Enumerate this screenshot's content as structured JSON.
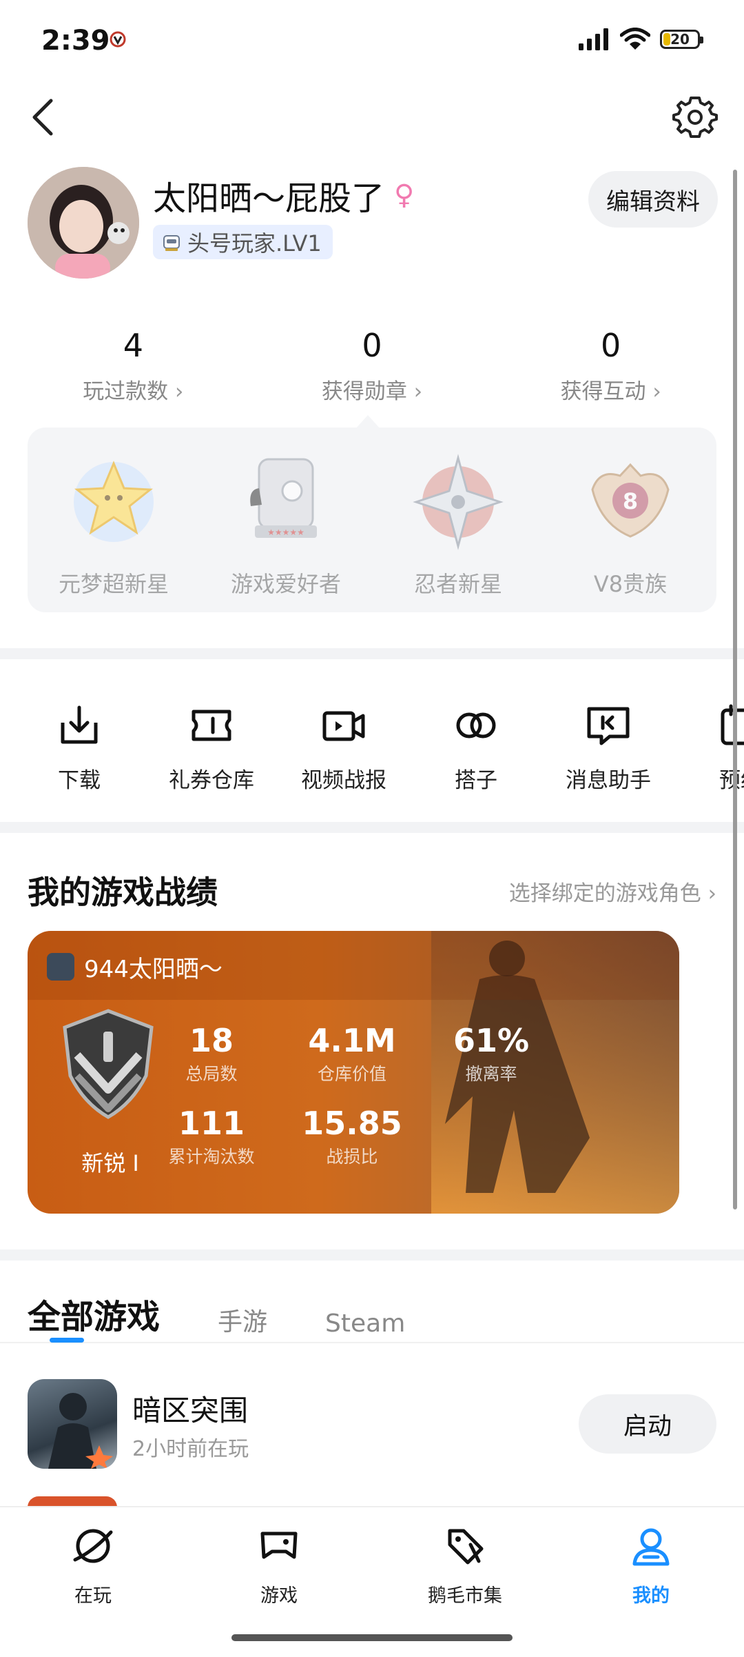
{
  "status_bar": {
    "time": "2:39",
    "battery": "20"
  },
  "profile": {
    "username": "太阳晒～屁股了",
    "gender_symbol": "♀",
    "level": "头号玩家.LV1",
    "edit_label": "编辑资料"
  },
  "stats": [
    {
      "value": "4",
      "label": "玩过款数"
    },
    {
      "value": "0",
      "label": "获得勋章"
    },
    {
      "value": "0",
      "label": "获得互动"
    }
  ],
  "badges": [
    {
      "label": "元梦超新星",
      "icon": "star-badge-icon"
    },
    {
      "label": "游戏爱好者",
      "icon": "gamer-badge-icon"
    },
    {
      "label": "忍者新星",
      "icon": "shuriken-badge-icon"
    },
    {
      "label": "V8贵族",
      "icon": "v8-badge-icon"
    }
  ],
  "tools": [
    {
      "label": "下载",
      "icon": "download-icon"
    },
    {
      "label": "礼券仓库",
      "icon": "coupon-icon"
    },
    {
      "label": "视频战报",
      "icon": "video-icon"
    },
    {
      "label": "搭子",
      "icon": "partner-icon"
    },
    {
      "label": "消息助手",
      "icon": "message-icon"
    },
    {
      "label": "预约",
      "icon": "calendar-icon"
    }
  ],
  "game_record": {
    "title": "我的游戏战绩",
    "bind_link": "选择绑定的游戏角色",
    "player": "944太阳晒～",
    "rank": "新锐 I",
    "stats": [
      {
        "value": "18",
        "label": "总局数"
      },
      {
        "value": "4.1M",
        "label": "仓库价值"
      },
      {
        "value": "61%",
        "label": "撤离率"
      },
      {
        "value": "111",
        "label": "累计淘汰数"
      },
      {
        "value": "15.85",
        "label": "战损比"
      }
    ]
  },
  "tabs": [
    {
      "label": "全部游戏",
      "active": true
    },
    {
      "label": "手游",
      "active": false
    },
    {
      "label": "Steam",
      "active": false
    }
  ],
  "games": [
    {
      "name": "暗区突围",
      "subtitle": "2小时前在玩",
      "action": "启动"
    }
  ],
  "bottom_nav": [
    {
      "label": "在玩",
      "icon": "planet-icon",
      "active": false
    },
    {
      "label": "游戏",
      "icon": "gamepad-icon",
      "active": false
    },
    {
      "label": "鹅毛市集",
      "icon": "tag-icon",
      "active": false
    },
    {
      "label": "我的",
      "icon": "profile-icon",
      "active": true
    }
  ],
  "colors": {
    "accent": "#1a8fff",
    "record_card": "#c85d14",
    "gender": "#f17ab0"
  }
}
